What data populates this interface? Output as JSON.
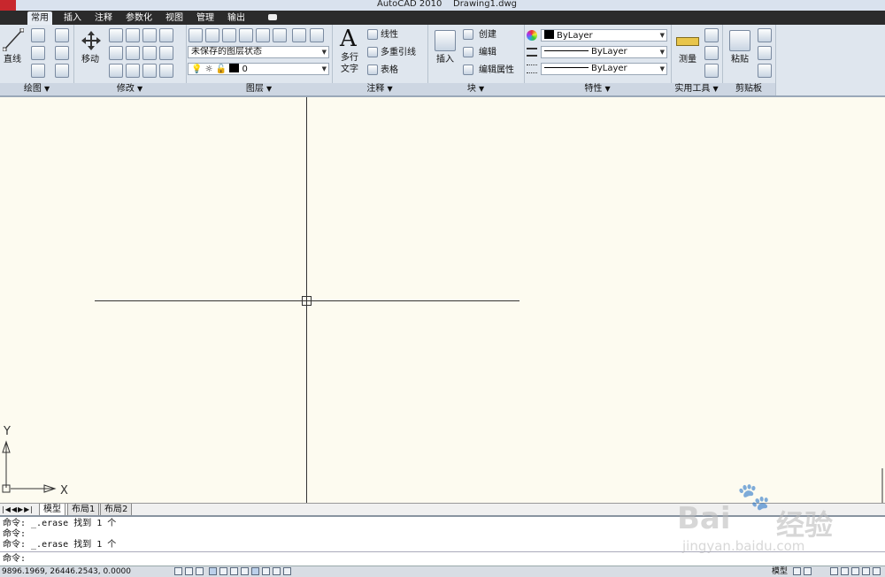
{
  "window": {
    "app_title": "AutoCAD 2010",
    "file_name": "Drawing1.dwg"
  },
  "tabs": [
    {
      "label": "常用",
      "active": true
    },
    {
      "label": "插入"
    },
    {
      "label": "注释"
    },
    {
      "label": "参数化"
    },
    {
      "label": "视图"
    },
    {
      "label": "管理"
    },
    {
      "label": "输出"
    }
  ],
  "panels": {
    "draw": {
      "title": "绘图",
      "line_label": "直线"
    },
    "modify": {
      "title": "修改",
      "move_label": "移动"
    },
    "layers": {
      "title": "图层",
      "layer_state": "未保存的图层状态",
      "current_layer": "0"
    },
    "annotation": {
      "title": "注释",
      "mtext_label_1": "多行",
      "mtext_label_2": "文字",
      "linear_label": "线性",
      "mleader_label": "多重引线",
      "table_label": "表格"
    },
    "block": {
      "title": "块",
      "insert_label": "插入",
      "create_label": "创建",
      "edit_label": "编辑",
      "edit_attr_label": "编辑属性"
    },
    "properties": {
      "title": "特性",
      "color": "ByLayer",
      "linetype": "ByLayer",
      "lineweight": "ByLayer"
    },
    "utilities": {
      "title": "实用工具",
      "measure_label": "测量"
    },
    "clipboard": {
      "title": "剪贴板",
      "paste_label": "粘贴"
    }
  },
  "drawing": {
    "ucs_y_label": "Y",
    "ucs_x_label": "X"
  },
  "layout_tabs": [
    {
      "label": "模型",
      "active": true
    },
    {
      "label": "布局1"
    },
    {
      "label": "布局2"
    }
  ],
  "command_history": [
    "命令: _.erase 找到 1 个",
    "命令:",
    "命令: _.erase 找到 1 个"
  ],
  "command_prompt": "命令:",
  "status": {
    "coordinates": "9896.1969,  26446.2543, 0.0000",
    "model_label": "模型"
  },
  "watermark": {
    "brand": "Bai",
    "brand2": "经验",
    "url": "jingyan.baidu.com"
  },
  "colors": {
    "accent": "#c8272d",
    "tabbar": "#2b2b2b",
    "canvas": "#fdfbf0"
  }
}
